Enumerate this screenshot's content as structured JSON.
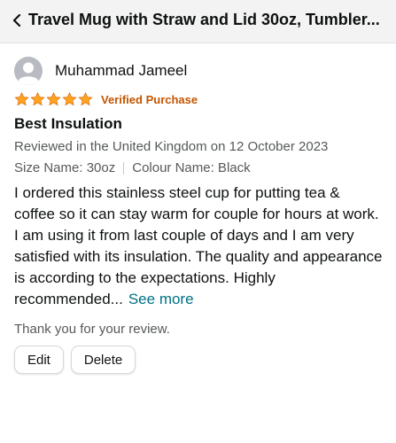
{
  "header": {
    "back_icon": "chevron-left-icon",
    "title": "Travel Mug with Straw and Lid 30oz, Tumbler..."
  },
  "review": {
    "reviewer_name": "Muhammad Jameel",
    "avatar_icon": "default-user-avatar",
    "rating": 5,
    "rating_max": 5,
    "verified_label": "Verified Purchase",
    "headline": "Best Insulation",
    "reviewed_info": "Reviewed in the United Kingdom on 12 October 2023",
    "size_name": "Size Name: 30oz",
    "colour_name": "Colour Name: Black",
    "body": "I ordered this stainless steel cup for putting tea & coffee so it can stay warm for couple for hours at work. I am using it from last couple of days and I am very satisfied with its insulation. The quality and appearance is according to the expectations. Highly recommended...",
    "see_more_label": "See more",
    "thank_you": "Thank you for your review.",
    "edit_label": "Edit",
    "delete_label": "Delete"
  },
  "colors": {
    "star": "#ffa41c",
    "verified": "#c45500",
    "link": "#007185",
    "muted_text": "#565959",
    "header_bg": "#f3f3f3"
  }
}
